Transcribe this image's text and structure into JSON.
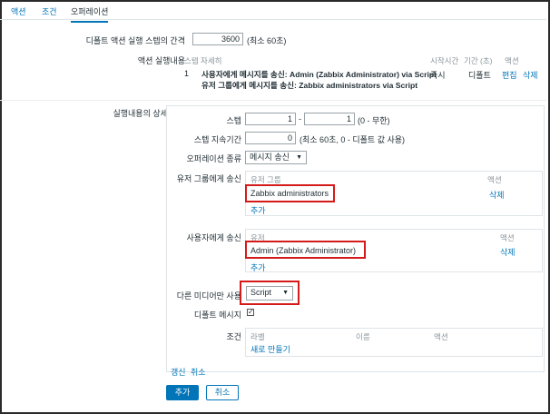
{
  "tabs": {
    "action": "액션",
    "conditions": "조건",
    "operations": "오퍼레이션"
  },
  "step_interval": {
    "label": "디폴트 액션 실행 스텝의 간격",
    "value": "3600",
    "hint": "(최소 60초)"
  },
  "operations_list": {
    "label": "액션 실행내용",
    "headers": {
      "step_detail": "스텝 자세히",
      "start": "시작시간",
      "duration": "기간 (초)",
      "action": "액션"
    },
    "row": {
      "step": "1",
      "line1": "사용자에게 메시지를 송신: Admin (Zabbix Administrator) via Script",
      "line2": "유저 그룹에게 메시지를 송신: Zabbix administrators via Script",
      "start": "즉시",
      "duration": "디폴트",
      "edit": "편집",
      "delete": "삭제"
    }
  },
  "details": {
    "label": "실행내용의 상세 정보",
    "step": {
      "label": "스텝",
      "from": "1",
      "to": "1",
      "hint": "(0 - 무한)"
    },
    "step_duration": {
      "label": "스텝 지속기간",
      "value": "0",
      "hint": "(최소 60초, 0 - 디폴트 값 사용)"
    },
    "operation_type": {
      "label": "오퍼레이션 종류",
      "value": "메시지 송신"
    },
    "send_to_groups": {
      "label": "유저 그룹에게 송신",
      "col_group": "유저 그룹",
      "col_action": "액션",
      "group": "Zabbix administrators",
      "remove": "삭제",
      "add": "추가"
    },
    "send_to_users": {
      "label": "사용자에게 송신",
      "col_user": "유저",
      "col_action": "액션",
      "user": "Admin (Zabbix Administrator)",
      "remove": "삭제",
      "add": "추가"
    },
    "send_only_to": {
      "label": "다른 미디어만 사용",
      "value": "Script"
    },
    "default_message": {
      "label": "디폴트 메시지"
    },
    "conditions": {
      "label": "조건",
      "col_label": "라벨",
      "col_name": "이름",
      "col_action": "액션",
      "new": "새로 만들기"
    },
    "update": "갱신",
    "cancel": "취소"
  },
  "buttons": {
    "add": "추가",
    "cancel": "취소"
  },
  "colors": {
    "link": "#0275b8",
    "highlight": "#d51a1a"
  }
}
